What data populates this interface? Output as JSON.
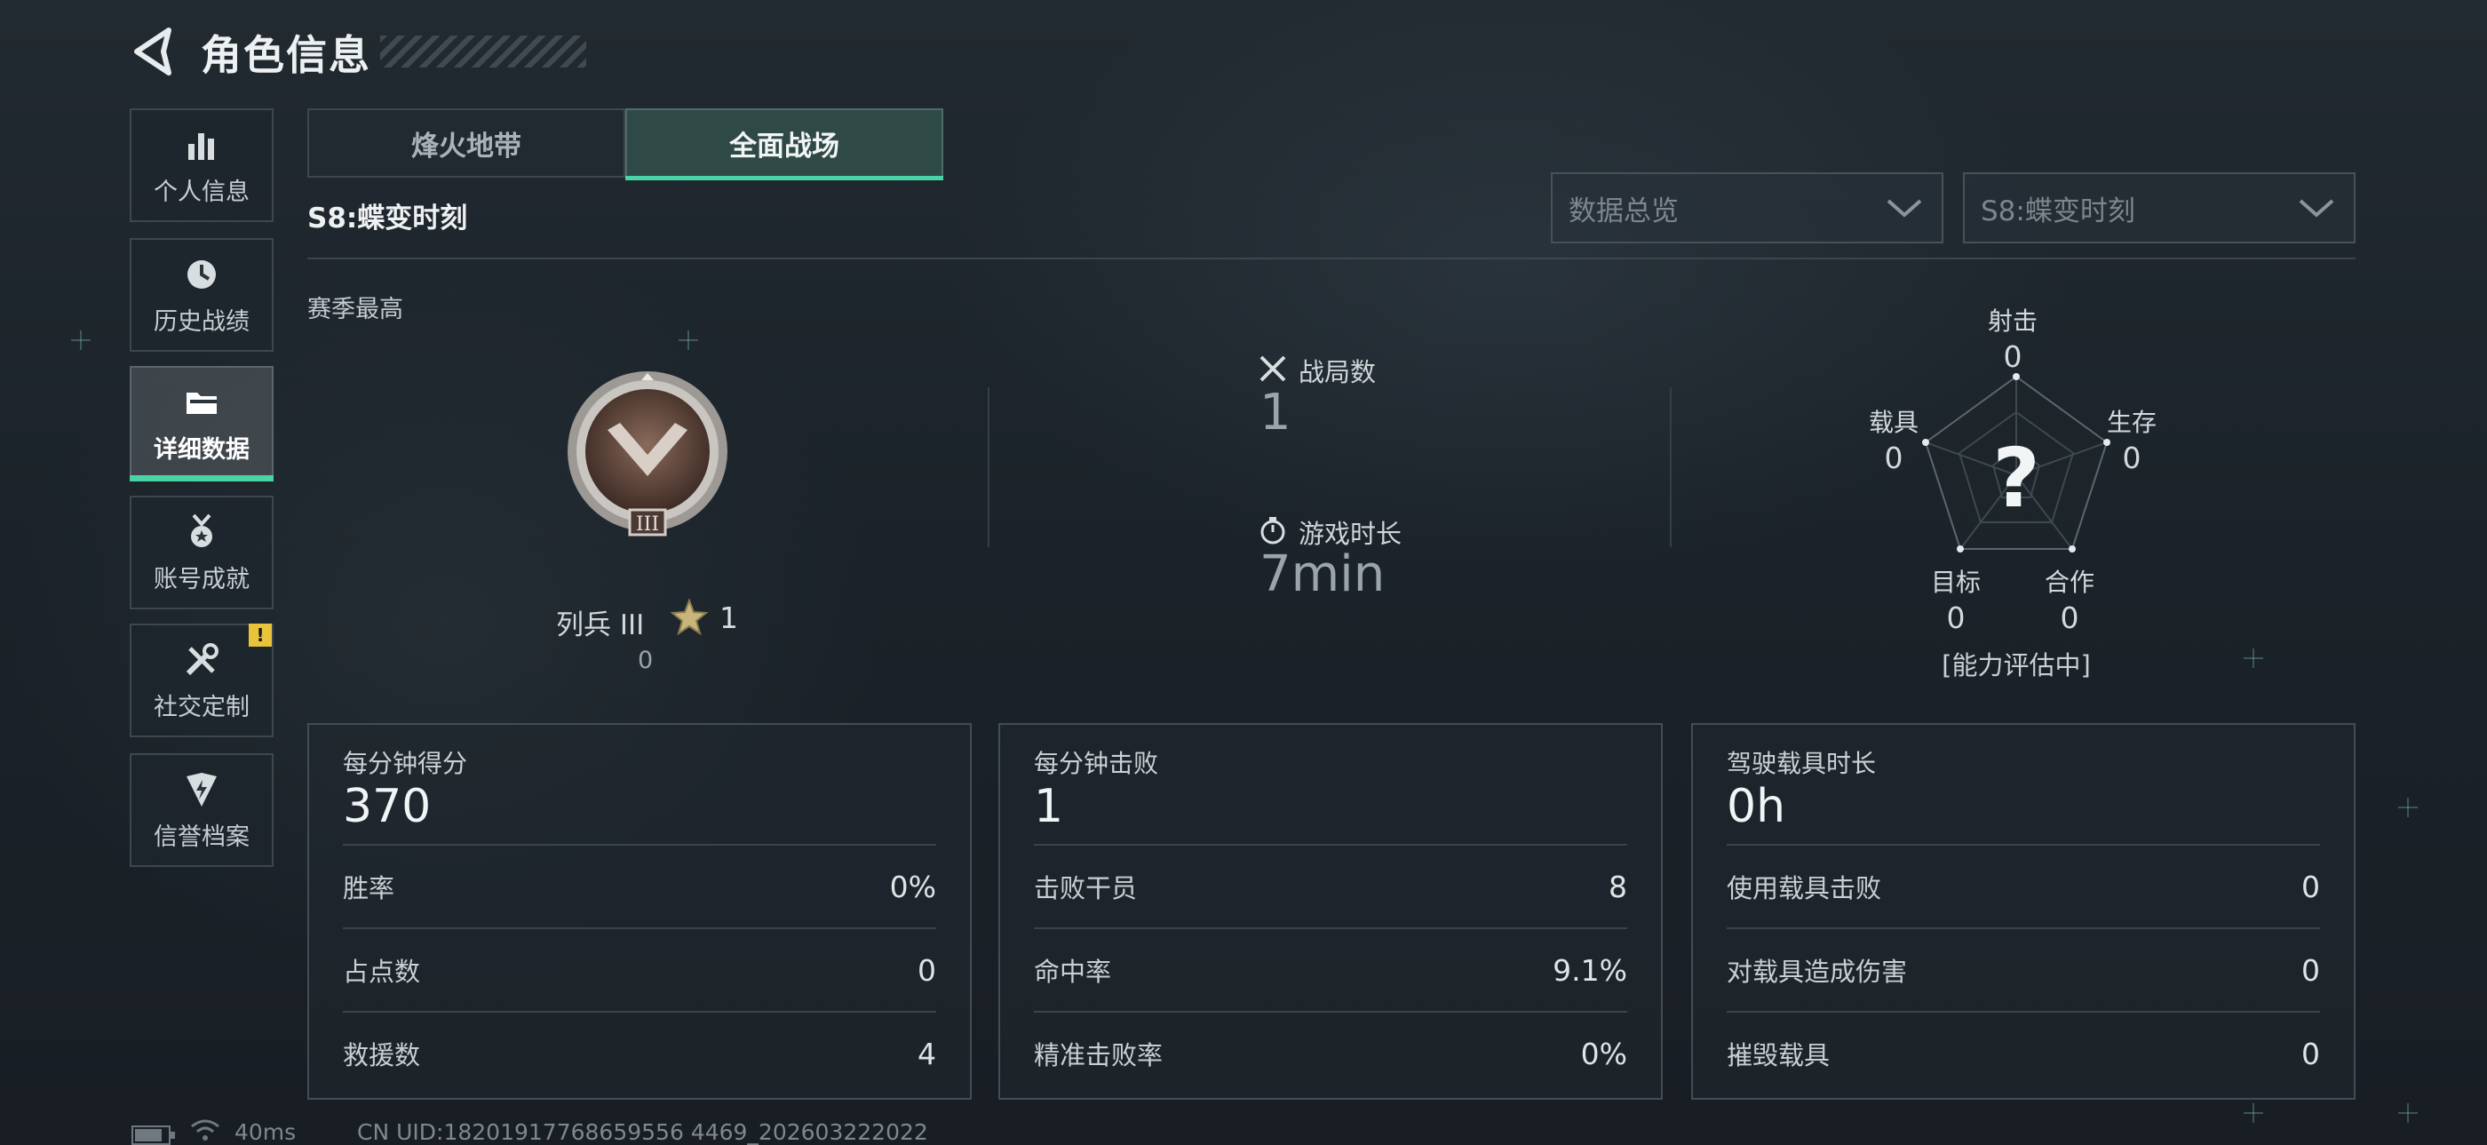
{
  "header": {
    "title": "角色信息"
  },
  "sidebar": {
    "items": [
      {
        "label": "个人信息",
        "icon": "bar-chart-icon"
      },
      {
        "label": "历史战绩",
        "icon": "history-clock-icon"
      },
      {
        "label": "详细数据",
        "icon": "folder-icon",
        "active": true
      },
      {
        "label": "账号成就",
        "icon": "medal-icon"
      },
      {
        "label": "社交定制",
        "icon": "tools-icon",
        "badge": "!"
      },
      {
        "label": "信誉档案",
        "icon": "shield-bolt-icon"
      }
    ]
  },
  "tabs": [
    {
      "label": "烽火地带",
      "active": false
    },
    {
      "label": "全面战场",
      "active": true
    }
  ],
  "season": {
    "title": "S8:蝶变时刻"
  },
  "filters": {
    "category": "数据总览",
    "season": "S8:蝶变时刻"
  },
  "season_best": {
    "label": "赛季最高",
    "rank": "列兵 III",
    "rank_numeral": "III",
    "stars": "1",
    "points": "0"
  },
  "summary": {
    "matches_label": "战局数",
    "matches_value": "1",
    "playtime_label": "游戏时长",
    "playtime_value": "7min"
  },
  "radar": {
    "shooting": {
      "label": "射击",
      "value": "0"
    },
    "survival": {
      "label": "生存",
      "value": "0"
    },
    "cooperation": {
      "label": "合作",
      "value": "0"
    },
    "objective": {
      "label": "目标",
      "value": "0"
    },
    "vehicle": {
      "label": "载具",
      "value": "0"
    },
    "center_mark": "?",
    "status": "[能力评估中]"
  },
  "panels": [
    {
      "title": "每分钟得分",
      "value": "370",
      "rows": [
        {
          "label": "胜率",
          "value": "0%"
        },
        {
          "label": "占点数",
          "value": "0"
        },
        {
          "label": "救援数",
          "value": "4"
        }
      ]
    },
    {
      "title": "每分钟击败",
      "value": "1",
      "rows": [
        {
          "label": "击败干员",
          "value": "8"
        },
        {
          "label": "命中率",
          "value": "9.1%"
        },
        {
          "label": "精准击败率",
          "value": "0%"
        }
      ]
    },
    {
      "title": "驾驶载具时长",
      "value": "0h",
      "rows": [
        {
          "label": "使用载具击败",
          "value": "0"
        },
        {
          "label": "对载具造成伤害",
          "value": "0"
        },
        {
          "label": "摧毁载具",
          "value": "0"
        }
      ]
    }
  ],
  "footer": {
    "ping": "40ms",
    "uid": "CN UID:18201917768659556 4469_202603222022"
  },
  "colors": {
    "accent": "#4ad3a4",
    "badge": "#e9c43a"
  }
}
